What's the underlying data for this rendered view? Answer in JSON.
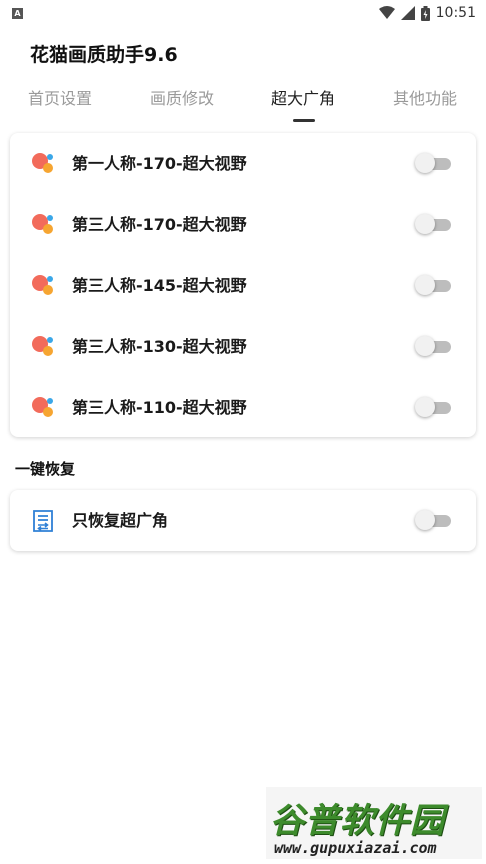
{
  "status_bar": {
    "app_icon_letter": "A",
    "time": "10:51"
  },
  "app": {
    "title": "花猫画质助手9.6"
  },
  "tabs": [
    {
      "label": "首页设置"
    },
    {
      "label": "画质修改"
    },
    {
      "label": "超大广角",
      "active": true
    },
    {
      "label": "其他功能"
    }
  ],
  "wide_angle_items": [
    {
      "label": "第一人称-170-超大视野",
      "enabled": false
    },
    {
      "label": "第三人称-170-超大视野",
      "enabled": false
    },
    {
      "label": "第三人称-145-超大视野",
      "enabled": false
    },
    {
      "label": "第三人称-130-超大视野",
      "enabled": false
    },
    {
      "label": "第三人称-110-超大视野",
      "enabled": false
    }
  ],
  "restore_section": {
    "title": "一键恢复",
    "items": [
      {
        "label": "只恢复超广角",
        "enabled": false
      }
    ]
  },
  "watermark": {
    "main": "谷普软件园",
    "url": "www.gupuxiazai.com"
  },
  "colors": {
    "icon_red": "#f26b5b",
    "icon_orange": "#f6a531",
    "icon_blue": "#3aa7e8",
    "toggle_track": "#bdbdbd",
    "restore_icon": "#2f80d6"
  }
}
